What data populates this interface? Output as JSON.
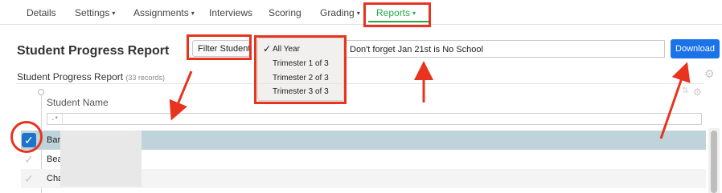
{
  "nav": {
    "tabs": [
      {
        "label": "Details",
        "caret": false
      },
      {
        "label": "Settings",
        "caret": true
      },
      {
        "label": "Assignments",
        "caret": true
      },
      {
        "label": "Interviews",
        "caret": false
      },
      {
        "label": "Scoring",
        "caret": false
      },
      {
        "label": "Grading",
        "caret": true
      },
      {
        "label": "Reports",
        "caret": true,
        "active": true
      }
    ],
    "caret_glyph": "▾"
  },
  "page": {
    "title": "Student Progress Report",
    "subtitle": "Student Progress Report",
    "record_count": "(33 records)"
  },
  "toolbar": {
    "filter_label": "Filter Students",
    "notice_text": "Don't forget Jan 21st is No School",
    "download_label": "Download"
  },
  "term_dropdown": {
    "selected": "All Year",
    "options": [
      "All Year",
      "Trimester 1 of 3",
      "Trimester 2 of 3",
      "Trimester 3 of 3"
    ]
  },
  "table": {
    "column_header": "Student Name",
    "filter_icon_glyph": ".*",
    "rows": [
      {
        "name": "Bar",
        "selected": true
      },
      {
        "name": "Bea",
        "selected": false
      },
      {
        "name": "Cha",
        "selected": false
      }
    ]
  },
  "colors": {
    "accent": "#2ba84a",
    "primary_button": "#1a73e8",
    "selected_row": "#bfd4da",
    "annotation_red": "#e8331f"
  },
  "icons": {
    "check": "✓",
    "gear": "⚙",
    "sort": "⇅"
  }
}
